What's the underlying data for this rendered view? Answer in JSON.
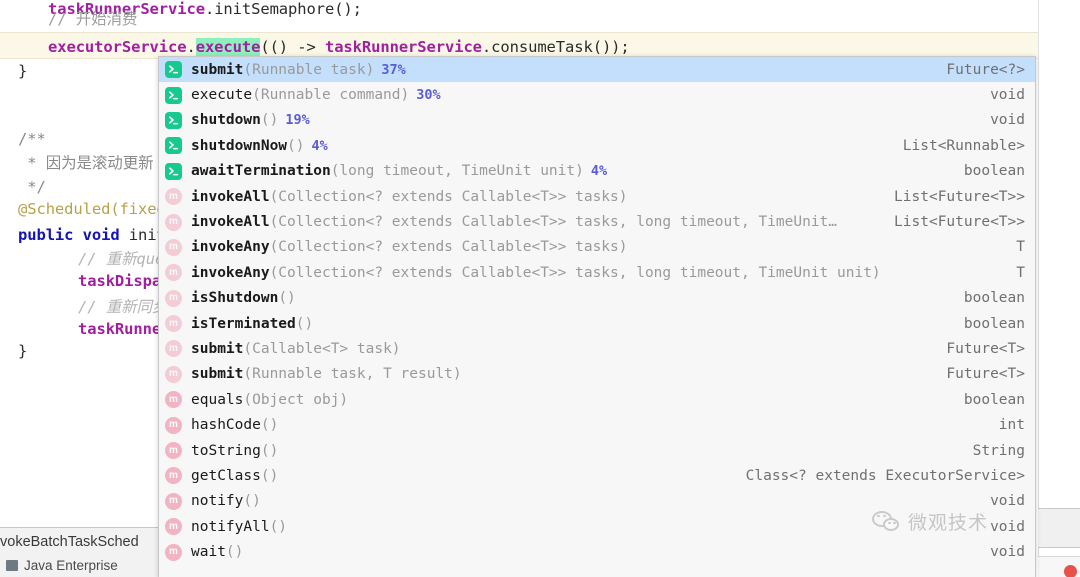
{
  "editor": {
    "lines": [
      {
        "indent": 1,
        "tokens": [
          {
            "t": "taskRunnerService",
            "c": "field"
          },
          {
            "t": ".",
            "c": "plain"
          },
          {
            "t": "initSemaphore",
            "c": "method"
          },
          {
            "t": "();",
            "c": "plain"
          }
        ]
      },
      {
        "indent": 1,
        "tokens": [
          {
            "t": "// 开始消费",
            "c": "comment"
          }
        ]
      },
      {
        "indent": 1,
        "tokens": [
          {
            "t": "executorService",
            "c": "field"
          },
          {
            "t": ".",
            "c": "plain"
          },
          {
            "t": "execute",
            "c": "selected"
          },
          {
            "t": "(() -> ",
            "c": "plain"
          },
          {
            "t": "taskRunnerService",
            "c": "field"
          },
          {
            "t": ".",
            "c": "plain"
          },
          {
            "t": "consumeTask",
            "c": "method"
          },
          {
            "t": "());",
            "c": "plain"
          }
        ]
      },
      {
        "indent": 0,
        "tokens": [
          {
            "t": "}",
            "c": "plain"
          }
        ]
      },
      {
        "indent": 0,
        "tokens": [
          {
            "t": "/**",
            "c": "doc"
          }
        ]
      },
      {
        "indent": 0,
        "tokens": [
          {
            "t": " * 因为是滚动更新 ",
            "c": "doc"
          }
        ]
      },
      {
        "indent": 0,
        "tokens": [
          {
            "t": " */",
            "c": "doc"
          }
        ]
      },
      {
        "indent": 0,
        "tokens": [
          {
            "t": "@Scheduled(fixedD",
            "c": "anno"
          }
        ]
      },
      {
        "indent": 0,
        "tokens": [
          {
            "t": "public void ",
            "c": "kw"
          },
          {
            "t": "init",
            "c": "method"
          }
        ]
      },
      {
        "indent": 2,
        "tokens": [
          {
            "t": "// 重新queue",
            "c": "comment-i"
          }
        ]
      },
      {
        "indent": 2,
        "tokens": [
          {
            "t": "taskDispatchS",
            "c": "field"
          }
        ]
      },
      {
        "indent": 2,
        "tokens": [
          {
            "t": "// 重新同步信号",
            "c": "comment-i"
          }
        ]
      },
      {
        "indent": 2,
        "tokens": [
          {
            "t": "taskRunnerSe",
            "c": "field"
          }
        ]
      },
      {
        "indent": 0,
        "tokens": [
          {
            "t": "}",
            "c": "plain"
          }
        ]
      }
    ]
  },
  "bottom_panel": {
    "truncated_label": "vokeBatchTaskSched",
    "group_label": "Java Enterprise"
  },
  "completion_popup": {
    "title": "code-completion-popup",
    "selection_color": "#c3dffc",
    "background_color": "#f7f7f7",
    "interface_icon_color": "#18c98f",
    "class_icon_color": "#f2b3c2",
    "percent_color": "#5b5bd6",
    "items": [
      {
        "icon": "interface-method-icon",
        "name": "submit",
        "params": "(Runnable task)",
        "percent": "37%",
        "ret": "Future<?>",
        "selected": true,
        "bold": true
      },
      {
        "icon": "interface-method-icon",
        "name": "execute",
        "params": "(Runnable command)",
        "percent": "30%",
        "ret": "void",
        "selected": false,
        "bold": false
      },
      {
        "icon": "interface-method-icon",
        "name": "shutdown",
        "params": "()",
        "percent": "19%",
        "ret": "void",
        "selected": false,
        "bold": true
      },
      {
        "icon": "interface-method-icon",
        "name": "shutdownNow",
        "params": "()",
        "percent": "4%",
        "ret": "List<Runnable>",
        "selected": false,
        "bold": true
      },
      {
        "icon": "interface-method-icon",
        "name": "awaitTermination",
        "params": "(long timeout, TimeUnit unit)",
        "percent": "4%",
        "ret": "boolean",
        "selected": false,
        "bold": true
      },
      {
        "icon": "class-method-icon",
        "name": "invokeAll",
        "params": "(Collection<? extends Callable<T>> tasks)",
        "percent": "",
        "ret": "List<Future<T>>",
        "selected": false,
        "bold": true
      },
      {
        "icon": "class-method-icon",
        "name": "invokeAll",
        "params": "(Collection<? extends Callable<T>> tasks, long timeout, TimeUnit…",
        "percent": "",
        "ret": "List<Future<T>>",
        "selected": false,
        "bold": true
      },
      {
        "icon": "class-method-icon",
        "name": "invokeAny",
        "params": "(Collection<? extends Callable<T>> tasks)",
        "percent": "",
        "ret": "T",
        "selected": false,
        "bold": true
      },
      {
        "icon": "class-method-icon",
        "name": "invokeAny",
        "params": "(Collection<? extends Callable<T>> tasks, long timeout, TimeUnit unit)",
        "percent": "",
        "ret": "T",
        "selected": false,
        "bold": true
      },
      {
        "icon": "class-method-icon",
        "name": "isShutdown",
        "params": "()",
        "percent": "",
        "ret": "boolean",
        "selected": false,
        "bold": true
      },
      {
        "icon": "class-method-icon",
        "name": "isTerminated",
        "params": "()",
        "percent": "",
        "ret": "boolean",
        "selected": false,
        "bold": true
      },
      {
        "icon": "class-method-icon",
        "name": "submit",
        "params": "(Callable<T> task)",
        "percent": "",
        "ret": "Future<T>",
        "selected": false,
        "bold": true
      },
      {
        "icon": "class-method-icon",
        "name": "submit",
        "params": "(Runnable task, T result)",
        "percent": "",
        "ret": "Future<T>",
        "selected": false,
        "bold": true
      },
      {
        "icon": "class-method-icon",
        "name": "equals",
        "params": "(Object obj)",
        "percent": "",
        "ret": "boolean",
        "selected": false,
        "bold": false
      },
      {
        "icon": "class-method-icon",
        "name": "hashCode",
        "params": "()",
        "percent": "",
        "ret": "int",
        "selected": false,
        "bold": false
      },
      {
        "icon": "class-method-icon",
        "name": "toString",
        "params": "()",
        "percent": "",
        "ret": "String",
        "selected": false,
        "bold": false
      },
      {
        "icon": "class-method-icon",
        "name": "getClass",
        "params": "()",
        "percent": "",
        "ret": "Class<? extends ExecutorService>",
        "selected": false,
        "bold": false
      },
      {
        "icon": "class-method-icon",
        "name": "notify",
        "params": "()",
        "percent": "",
        "ret": "void",
        "selected": false,
        "bold": false
      },
      {
        "icon": "class-method-icon",
        "name": "notifyAll",
        "params": "()",
        "percent": "",
        "ret": "void",
        "selected": false,
        "bold": false
      },
      {
        "icon": "class-method-icon",
        "name": "wait",
        "params": "()",
        "percent": "",
        "ret": "void",
        "selected": false,
        "bold": false
      }
    ]
  },
  "watermark": {
    "text": "微观技术",
    "logo": "wechat-icon"
  }
}
